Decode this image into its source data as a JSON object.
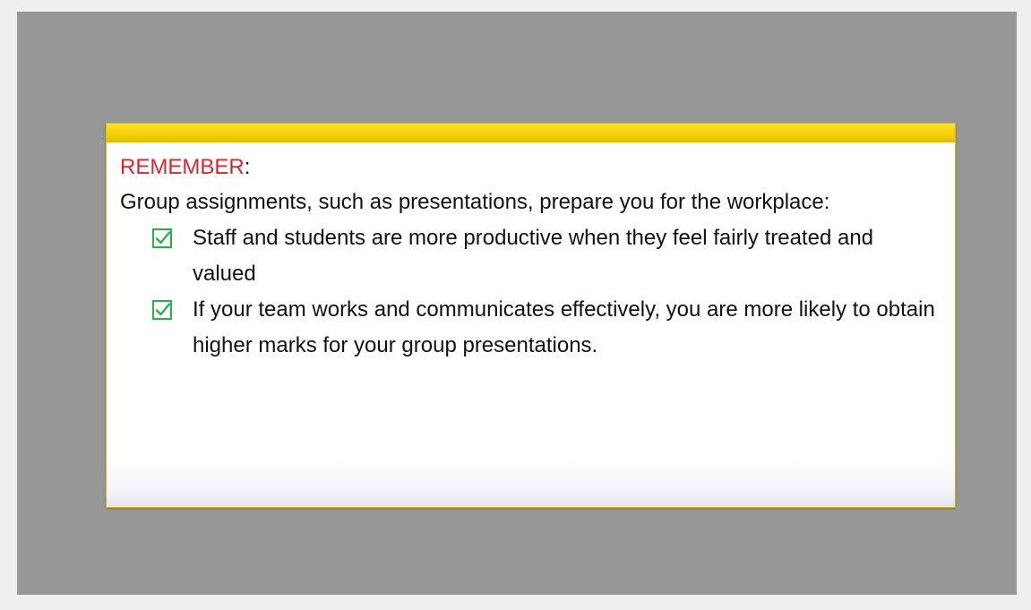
{
  "callout": {
    "heading": "REMEMBER",
    "heading_suffix": ":",
    "intro": "Group assignments, such as presentations, prepare you for the workplace:",
    "items": [
      {
        "icon": "checkbox-checked-icon",
        "text": "Staff and students are more productive when they feel fairly treated and valued"
      },
      {
        "icon": "checkbox-checked-icon",
        "text": "If your team works and communicates effectively, you are more likely to obtain higher marks for your group presentations."
      }
    ]
  },
  "colors": {
    "page_background": "#efefef",
    "stage_background": "#979797",
    "card_header_bar": "#f4cf00",
    "heading_accent": "#d92530",
    "check_icon": "#2ab24a"
  }
}
